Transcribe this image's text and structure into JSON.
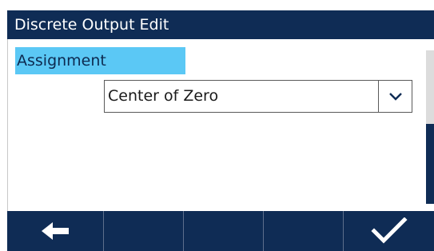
{
  "title": "Discrete Output Edit",
  "form": {
    "assignment_label": "Assignment",
    "assignment_value": "Center of Zero"
  },
  "scrollbar": {
    "position_fraction": 0.5
  },
  "softkeys": [
    {
      "icon": "arrow-left-icon"
    },
    {
      "icon": ""
    },
    {
      "icon": ""
    },
    {
      "icon": ""
    },
    {
      "icon": "checkmark-icon"
    }
  ],
  "colors": {
    "title_bar": "#0f2c55",
    "label_highlight": "#5bc8f5",
    "softkey_bar": "#0f2c55"
  }
}
